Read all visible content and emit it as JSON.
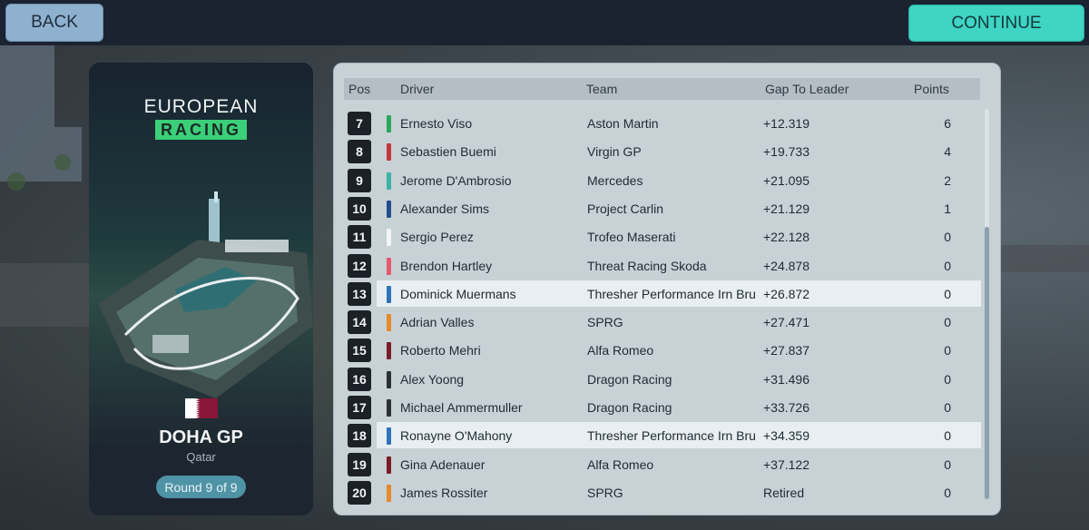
{
  "nav": {
    "back_label": "BACK",
    "continue_label": "CONTINUE"
  },
  "event": {
    "logo_top": "EUROPEAN",
    "logo_bottom": "RACING",
    "name": "DOHA GP",
    "country": "Qatar",
    "round": "Round 9 of 9"
  },
  "table": {
    "headers": {
      "pos": "Pos",
      "driver": "Driver",
      "team": "Team",
      "gap": "Gap To Leader",
      "points": "Points"
    },
    "rows": [
      {
        "pos": "7",
        "driver": "Ernesto Viso",
        "team": "Aston Martin",
        "gap": "+12.319",
        "points": "6",
        "color": "#2aa85a",
        "highlight": false
      },
      {
        "pos": "8",
        "driver": "Sebastien Buemi",
        "team": "Virgin GP",
        "gap": "+19.733",
        "points": "4",
        "color": "#c2383a",
        "highlight": false
      },
      {
        "pos": "9",
        "driver": "Jerome D'Ambrosio",
        "team": "Mercedes",
        "gap": "+21.095",
        "points": "2",
        "color": "#3bb3a7",
        "highlight": false
      },
      {
        "pos": "10",
        "driver": "Alexander Sims",
        "team": "Project Carlin",
        "gap": "+21.129",
        "points": "1",
        "color": "#234e8c",
        "highlight": false
      },
      {
        "pos": "11",
        "driver": "Sergio Perez",
        "team": "Trofeo Maserati",
        "gap": "+22.128",
        "points": "0",
        "color": "#f3f5f7",
        "highlight": false
      },
      {
        "pos": "12",
        "driver": "Brendon Hartley",
        "team": "Threat Racing Skoda",
        "gap": "+24.878",
        "points": "0",
        "color": "#e45a6c",
        "highlight": false
      },
      {
        "pos": "13",
        "driver": "Dominick Muermans",
        "team": "Thresher Performance Irn Bru",
        "gap": "+26.872",
        "points": "0",
        "color": "#2f74b8",
        "highlight": true
      },
      {
        "pos": "14",
        "driver": "Adrian Valles",
        "team": "SPRG",
        "gap": "+27.471",
        "points": "0",
        "color": "#e48a2c",
        "highlight": false
      },
      {
        "pos": "15",
        "driver": "Roberto Mehri",
        "team": "Alfa Romeo",
        "gap": "+27.837",
        "points": "0",
        "color": "#7a1c25",
        "highlight": false
      },
      {
        "pos": "16",
        "driver": "Alex Yoong",
        "team": "Dragon Racing",
        "gap": "+31.496",
        "points": "0",
        "color": "#2b3036",
        "highlight": false
      },
      {
        "pos": "17",
        "driver": "Michael Ammermuller",
        "team": "Dragon Racing",
        "gap": "+33.726",
        "points": "0",
        "color": "#2b3036",
        "highlight": false
      },
      {
        "pos": "18",
        "driver": "Ronayne O'Mahony",
        "team": "Thresher Performance Irn Bru",
        "gap": "+34.359",
        "points": "0",
        "color": "#2f74b8",
        "highlight": true
      },
      {
        "pos": "19",
        "driver": "Gina Adenauer",
        "team": "Alfa Romeo",
        "gap": "+37.122",
        "points": "0",
        "color": "#7a1c25",
        "highlight": false
      },
      {
        "pos": "20",
        "driver": "James Rossiter",
        "team": "SPRG",
        "gap": "Retired",
        "points": "0",
        "color": "#e48a2c",
        "highlight": false
      }
    ]
  }
}
